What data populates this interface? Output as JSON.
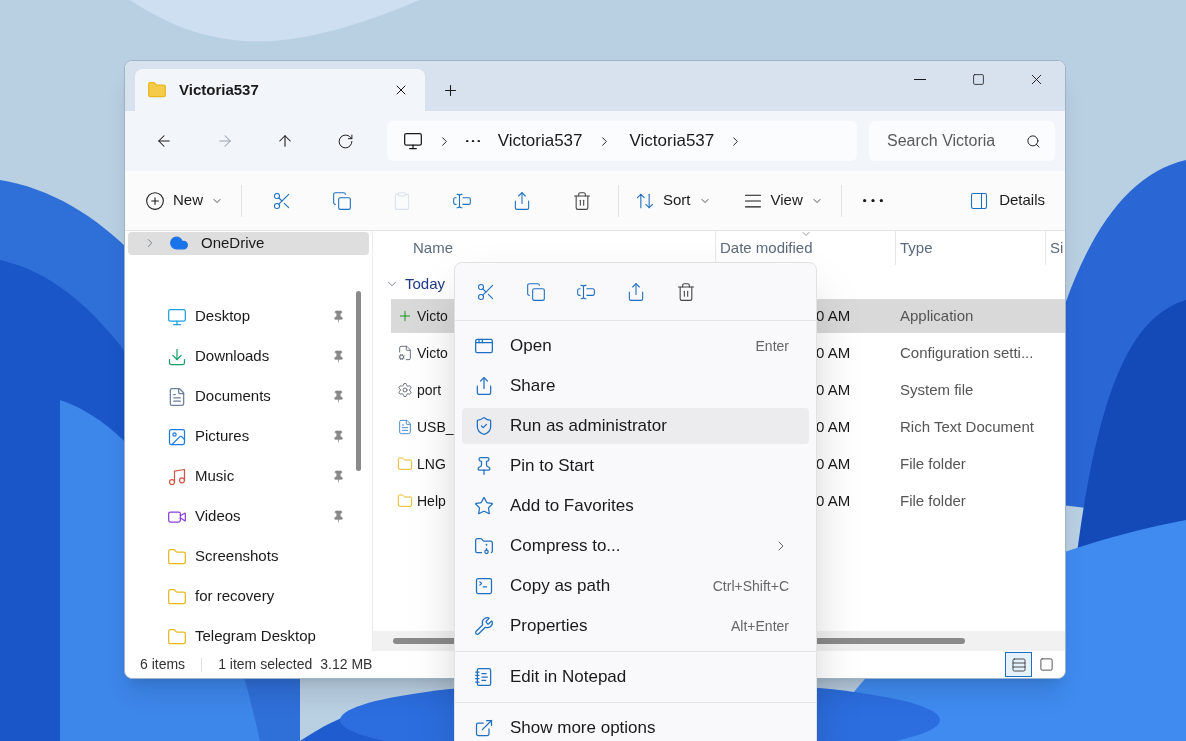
{
  "window": {
    "tab": {
      "title": "Victoria537",
      "selected": true
    }
  },
  "address_bar": {
    "segments": [
      "Victoria537",
      "Victoria537"
    ]
  },
  "search": {
    "placeholder": "Search Victoria"
  },
  "toolbar": {
    "new": "New",
    "actions": [
      {
        "disabled": false
      },
      {
        "disabled": false
      },
      {
        "disabled": true
      },
      {
        "disabled": false
      },
      {
        "disabled": false
      },
      {
        "disabled": false
      }
    ],
    "sort": "Sort",
    "view": "View",
    "details": "Details"
  },
  "sidebar": {
    "top": {
      "label": "OneDrive",
      "selected": true,
      "expanded": false
    },
    "items": [
      {
        "label": "Desktop",
        "pinned": true
      },
      {
        "label": "Downloads",
        "pinned": true
      },
      {
        "label": "Documents",
        "pinned": true
      },
      {
        "label": "Pictures",
        "pinned": true
      },
      {
        "label": "Music",
        "pinned": true
      },
      {
        "label": "Videos",
        "pinned": true
      },
      {
        "label": "Screenshots",
        "pinned": false
      },
      {
        "label": "for recovery",
        "pinned": false
      },
      {
        "label": "Telegram Desktop",
        "pinned": false
      }
    ]
  },
  "table": {
    "columns": [
      {
        "label": "Name",
        "sorted": false
      },
      {
        "label": "Date modified",
        "sorted": true
      },
      {
        "label": "Type",
        "sorted": false
      },
      {
        "label": "Si",
        "sorted": false
      }
    ],
    "groups": [
      {
        "label": "Today",
        "expanded": true,
        "rows": [
          {
            "kind": "application",
            "name": "Victo",
            "date": "0 AM",
            "type": "Application",
            "selected": true
          },
          {
            "kind": "config",
            "name": "Victo",
            "date": "0 AM",
            "type": "Configuration setti...",
            "selected": false
          },
          {
            "kind": "system",
            "name": "port",
            "date": "0 AM",
            "type": "System file",
            "selected": false
          },
          {
            "kind": "document",
            "name": "USB_",
            "date": "0 AM",
            "type": "Rich Text Document",
            "selected": false
          },
          {
            "kind": "folder",
            "name": "LNG",
            "date": "0 AM",
            "type": "File folder",
            "selected": false
          },
          {
            "kind": "folder",
            "name": "Help",
            "date": "0 AM",
            "type": "File folder",
            "selected": false
          }
        ]
      }
    ]
  },
  "status_bar": {
    "item_count": "6 items",
    "selection": "1 item selected",
    "size": "3.12 MB",
    "view_modes": [
      {
        "selected": true
      },
      {
        "selected": false
      }
    ]
  },
  "context_menu": {
    "sections": [
      [
        {
          "label": "Open",
          "shortcut": "Enter",
          "selected": false
        },
        {
          "label": "Share",
          "selected": false
        },
        {
          "label": "Run as administrator",
          "selected": true
        },
        {
          "label": "Pin to Start",
          "selected": false
        },
        {
          "label": "Add to Favorites",
          "selected": false
        },
        {
          "label": "Compress to...",
          "submenu": true,
          "selected": false
        },
        {
          "label": "Copy as path",
          "shortcut": "Ctrl+Shift+C",
          "selected": false
        },
        {
          "label": "Properties",
          "shortcut": "Alt+Enter",
          "selected": false
        }
      ],
      [
        {
          "label": "Edit in Notepad",
          "selected": false
        }
      ],
      [
        {
          "label": "Show more options",
          "selected": false
        }
      ]
    ]
  }
}
